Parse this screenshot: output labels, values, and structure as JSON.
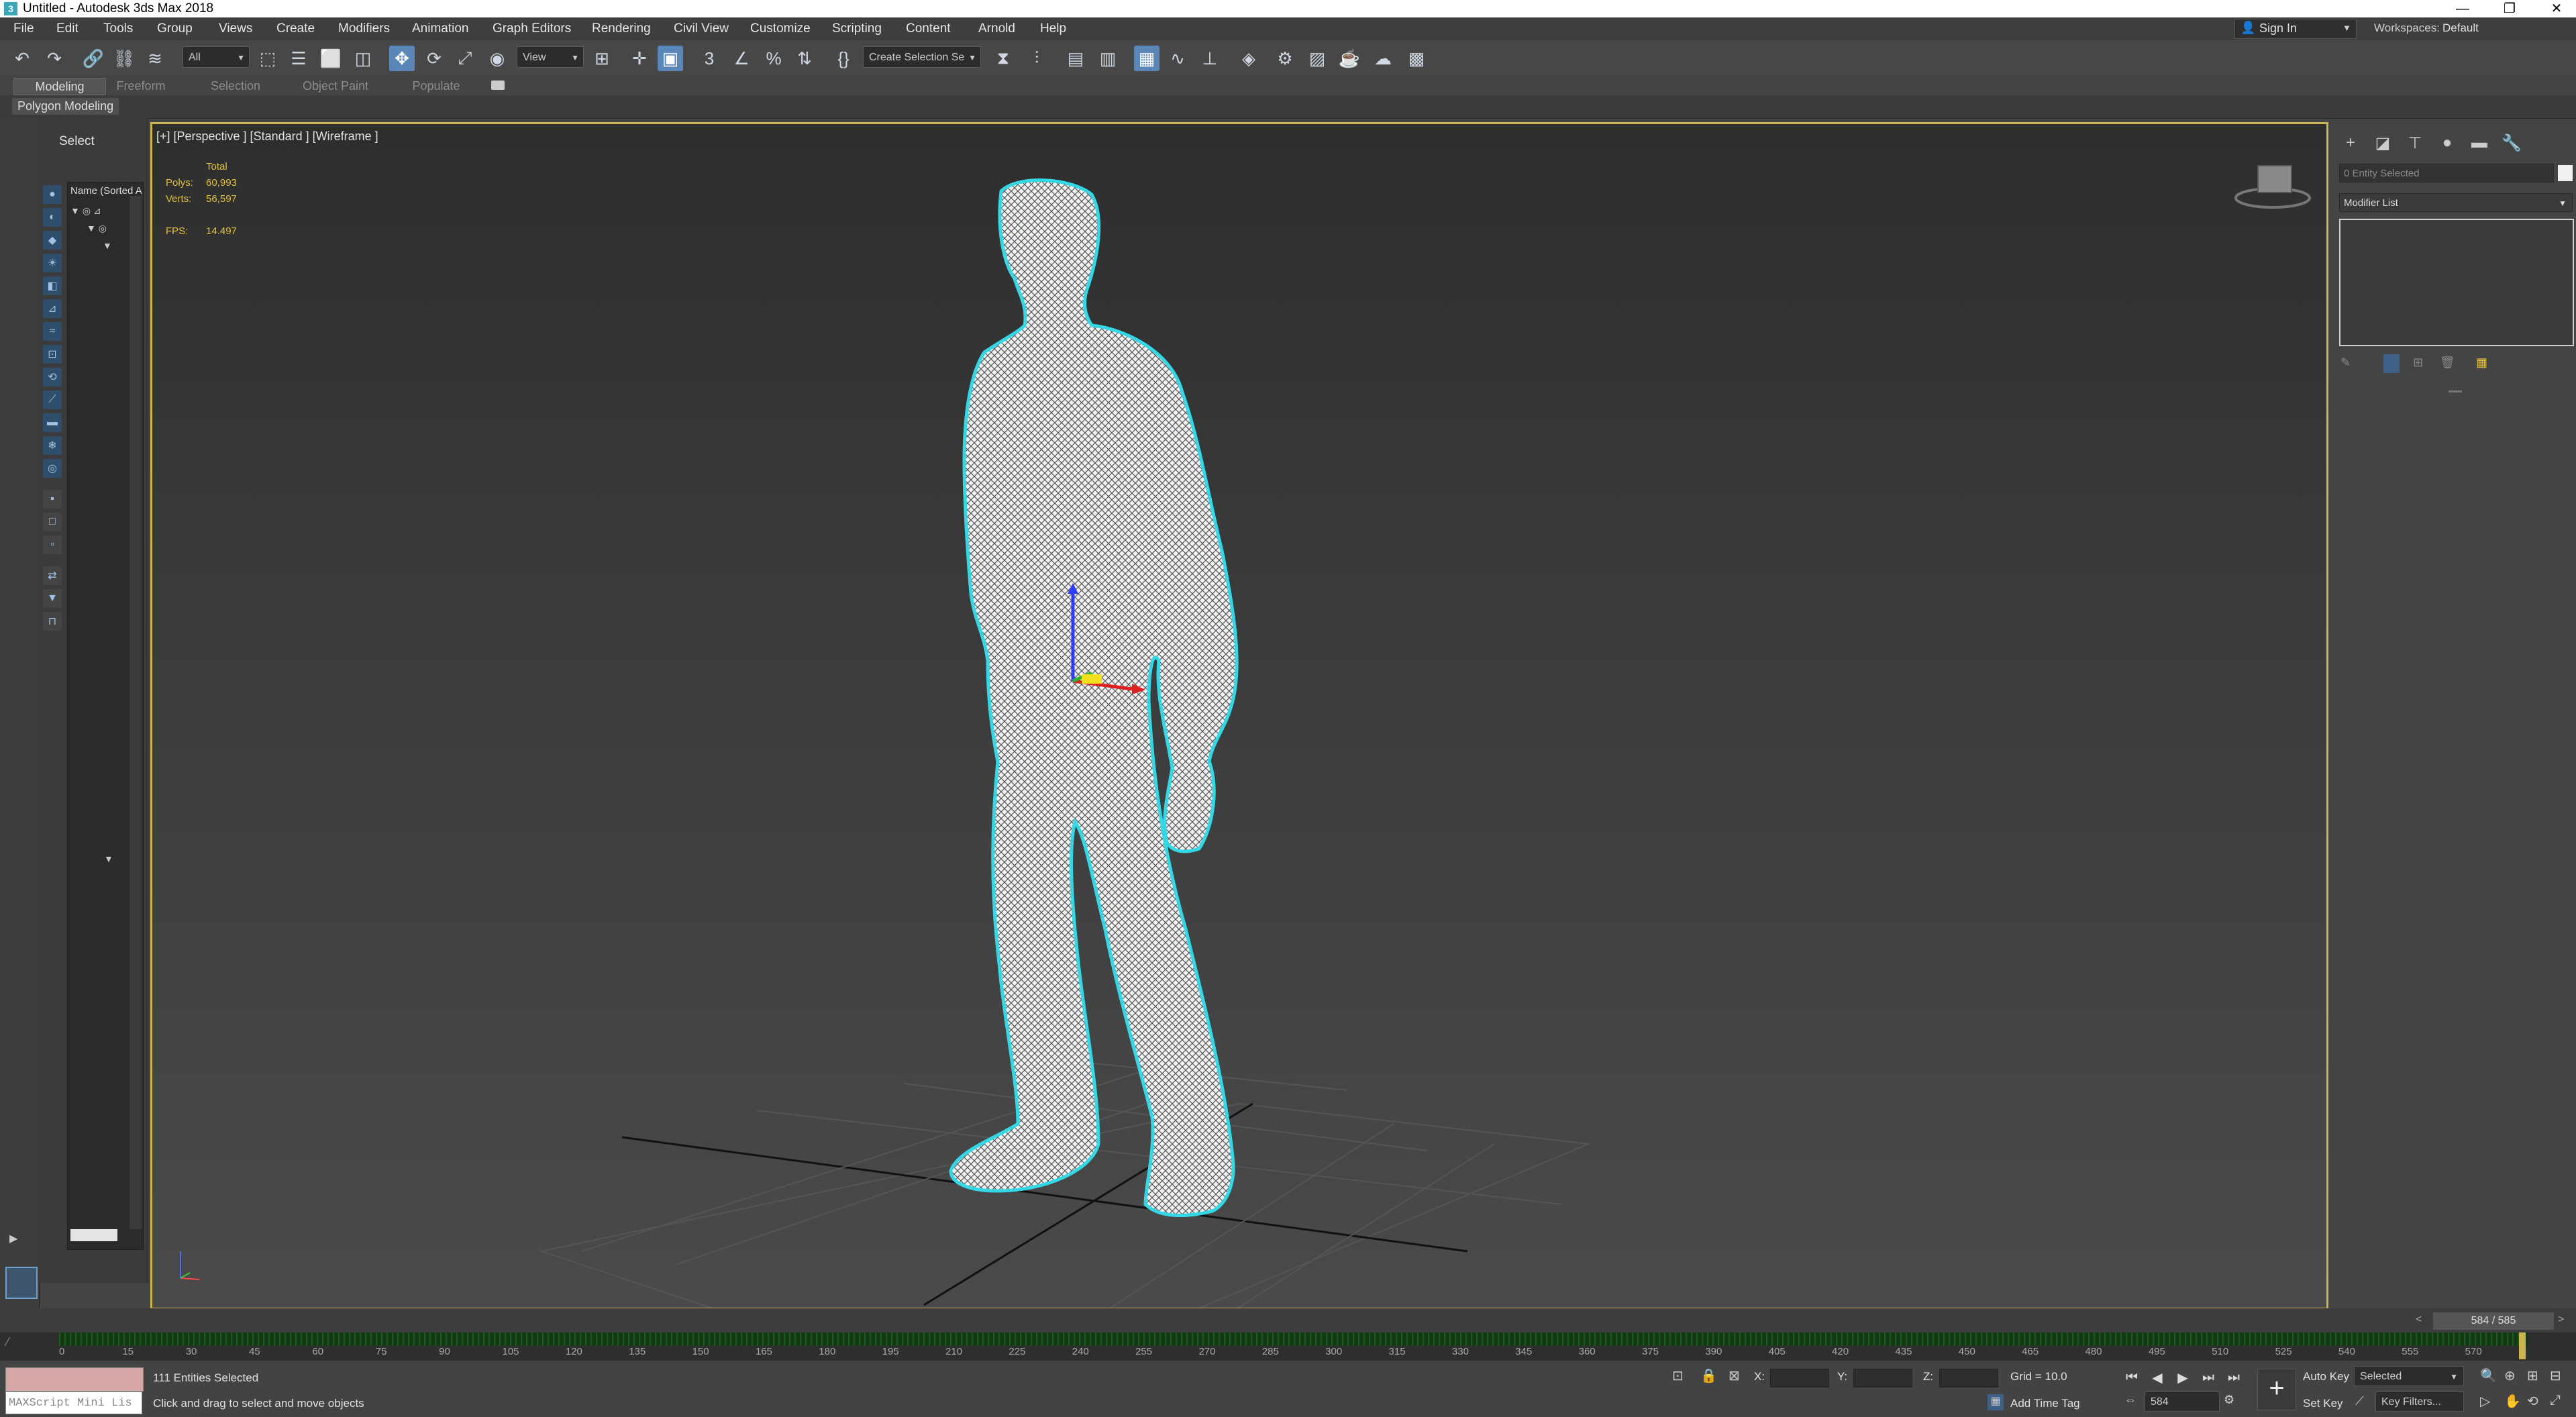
{
  "window": {
    "title": "Untitled - Autodesk 3ds Max 2018",
    "controls": [
      "—",
      "❐",
      "✕"
    ]
  },
  "menu": {
    "items": [
      "File",
      "Edit",
      "Tools",
      "Group",
      "Views",
      "Create",
      "Modifiers",
      "Animation",
      "Graph Editors",
      "Rendering",
      "Civil View",
      "Customize",
      "Scripting",
      "Content",
      "Arnold",
      "Help"
    ],
    "sign_in": "Sign In",
    "workspaces_label": "Workspaces:",
    "workspaces_value": "Default"
  },
  "toolbar": {
    "selection_filter": "All",
    "ref_coord": "View",
    "named_selection": "Create Selection Se"
  },
  "ribbon": {
    "tabs": [
      "Modeling",
      "Freeform",
      "Selection",
      "Object Paint",
      "Populate"
    ],
    "active_tab": "Modeling",
    "panel_label": "Polygon Modeling"
  },
  "explorer": {
    "header": "Select",
    "column": "Name (Sorted A"
  },
  "viewport": {
    "label": "[+] [Perspective ] [Standard ] [Wireframe ]",
    "stats": {
      "total_label": "Total",
      "polys_label": "Polys:",
      "polys_value": "60,993",
      "verts_label": "Verts:",
      "verts_value": "56,597",
      "fps_label": "FPS:",
      "fps_value": "14.497"
    }
  },
  "command_panel": {
    "name_field": "0 Entity Selected",
    "modifier_list": "Modifier List"
  },
  "timeline": {
    "frame_counter": "584 / 585",
    "ticks": [
      "0",
      "15",
      "30",
      "45",
      "60",
      "75",
      "90",
      "105",
      "120",
      "135",
      "150",
      "165",
      "180",
      "195",
      "210",
      "225",
      "240",
      "255",
      "270",
      "285",
      "300",
      "315",
      "330",
      "345",
      "360",
      "375",
      "390",
      "405",
      "420",
      "435",
      "450",
      "465",
      "480",
      "495",
      "510",
      "525",
      "540",
      "555",
      "570"
    ]
  },
  "status": {
    "selected": "111 Entities Selected",
    "prompt": "Click and drag to select and move objects",
    "maxscript_placeholder": "MAXScript Mini Lis",
    "x_label": "X:",
    "y_label": "Y:",
    "z_label": "Z:",
    "grid": "Grid = 10.0",
    "add_time_tag": "Add Time Tag",
    "auto_key": "Auto Key",
    "set_key": "Set Key",
    "key_mode": "Selected",
    "key_filters": "Key Filters...",
    "current_frame": "584"
  }
}
